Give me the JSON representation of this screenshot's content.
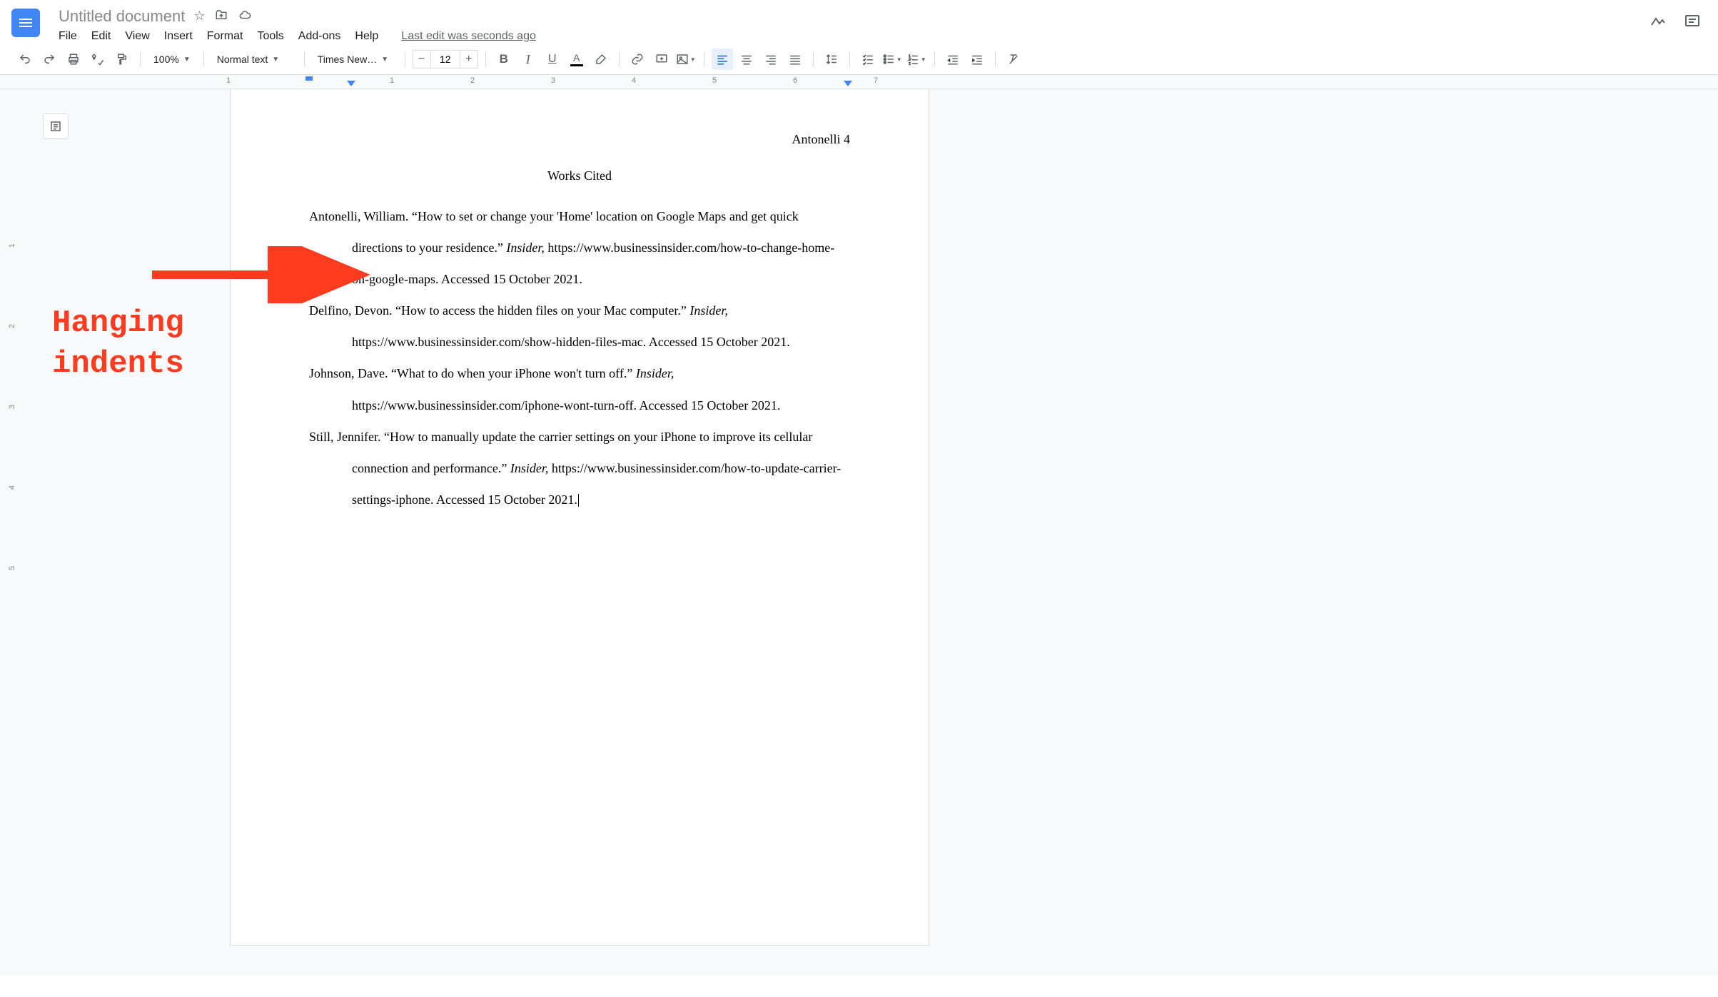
{
  "header": {
    "doc_title": "Untitled document",
    "menus": [
      "File",
      "Edit",
      "View",
      "Insert",
      "Format",
      "Tools",
      "Add-ons",
      "Help"
    ],
    "last_edit": "Last edit was seconds ago"
  },
  "toolbar": {
    "zoom": "100%",
    "style": "Normal text",
    "font": "Times New…",
    "font_size": "12"
  },
  "ruler": {
    "h_marks": [
      "1",
      "1",
      "2",
      "3",
      "4",
      "5",
      "6",
      "7"
    ],
    "v_marks": [
      "1",
      "2",
      "3",
      "4",
      "5"
    ]
  },
  "document": {
    "page_header": "Antonelli 4",
    "title": "Works Cited",
    "citations": [
      {
        "author_title": "Antonelli, William. “How to set or change your 'Home' location on Google Maps and get quick directions to your residence.” ",
        "publication": "Insider,",
        "rest": " https://www.businessinsider.com/how-to-change-home-on-google-maps. Accessed 15 October 2021."
      },
      {
        "author_title": "Delfino, Devon. “How to access the hidden files on your Mac computer.” ",
        "publication": "Insider,",
        "rest": " https://www.businessinsider.com/show-hidden-files-mac. Accessed 15 October 2021."
      },
      {
        "author_title": "Johnson, Dave. “What to do when your iPhone won't turn off.” ",
        "publication": "Insider,",
        "rest": " https://www.businessinsider.com/iphone-wont-turn-off. Accessed 15 October 2021."
      },
      {
        "author_title": "Still, Jennifer. “How to manually update the carrier settings on your iPhone to improve its cellular connection and performance.” ",
        "publication": "Insider,",
        "rest": " https://www.businessinsider.com/how-to-update-carrier-settings-iphone. Accessed 15 October 2021."
      }
    ]
  },
  "annotation": {
    "text_line1": "Hanging",
    "text_line2": "indents"
  }
}
